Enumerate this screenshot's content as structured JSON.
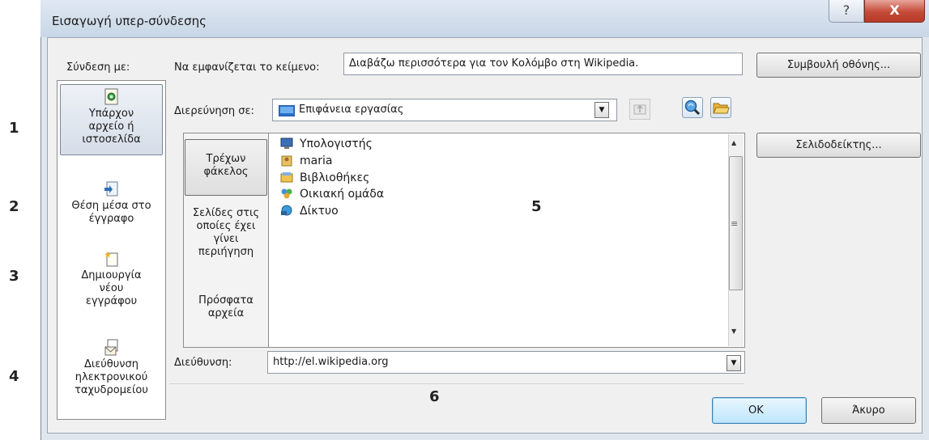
{
  "dialog": {
    "title": "Εισαγωγή υπερ-σύνδεσης",
    "help_label": "?",
    "close_label": "X"
  },
  "link_with": {
    "label": "Σύνδεση με:",
    "items": [
      {
        "icon": "existing-file-icon",
        "label": "Υπάρχον αρχείο ή ιστοσελίδα"
      },
      {
        "icon": "place-in-document-icon",
        "label": "Θέση μέσα στο έγγραφο"
      },
      {
        "icon": "new-document-icon",
        "label": "Δημιουργία νέου εγγράφου"
      },
      {
        "icon": "email-address-icon",
        "label": "Διεύθυνση ηλεκτρονικού ταχυδρομείου"
      }
    ]
  },
  "side_numbers": [
    "1",
    "2",
    "3",
    "4"
  ],
  "text_to_display": {
    "label": "Να εμφανίζεται το κείμενο:",
    "value": "Διαβάζω περισσότερα για τον Κολόμβο στη Wikipedia."
  },
  "screentip_button": "Συμβουλή οθόνης...",
  "look_in": {
    "label": "Διερεύνηση σε:",
    "value": "Επιφάνεια εργασίας"
  },
  "bookmark_button": "Σελιδοδείκτης...",
  "browse_tabs": [
    {
      "label": "Τρέχων φάκελος",
      "selected": true
    },
    {
      "label": "Σελίδες στις οποίες έχει γίνει περιήγηση",
      "selected": false
    },
    {
      "label": "Πρόσφατα αρχεία",
      "selected": false
    }
  ],
  "files": [
    {
      "icon": "computer-icon",
      "name": "Υπολογιστής"
    },
    {
      "icon": "user-folder-icon",
      "name": "maria"
    },
    {
      "icon": "libraries-icon",
      "name": "Βιβλιοθήκες"
    },
    {
      "icon": "homegroup-icon",
      "name": "Οικιακή ομάδα"
    },
    {
      "icon": "network-icon",
      "name": "Δίκτυο"
    }
  ],
  "address": {
    "label": "Διεύθυνση:",
    "value": "http://el.wikipedia.org"
  },
  "callout_5": "5",
  "callout_6": "6",
  "ok_button": "OK",
  "cancel_button": "Άκυρο"
}
